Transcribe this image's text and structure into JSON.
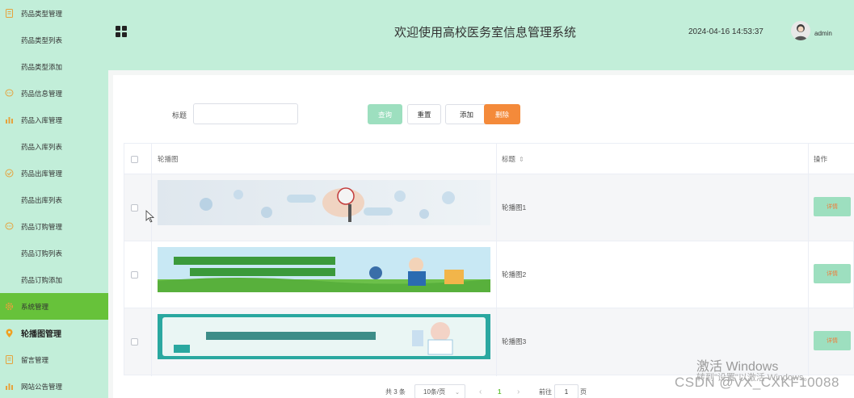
{
  "sidebar": {
    "items": [
      {
        "label": "药品类型管理",
        "type": "group",
        "icon": "document-icon"
      },
      {
        "label": "药品类型列表",
        "type": "sub"
      },
      {
        "label": "药品类型添加",
        "type": "sub"
      },
      {
        "label": "药品信息管理",
        "type": "group",
        "icon": "chat-icon"
      },
      {
        "label": "药品入库管理",
        "type": "group",
        "icon": "bar-chart-icon"
      },
      {
        "label": "药品入库列表",
        "type": "sub"
      },
      {
        "label": "药品出库管理",
        "type": "group",
        "icon": "check-circle-icon"
      },
      {
        "label": "药品出库列表",
        "type": "sub"
      },
      {
        "label": "药品订购管理",
        "type": "group",
        "icon": "chat-icon"
      },
      {
        "label": "药品订购列表",
        "type": "sub"
      },
      {
        "label": "药品订购添加",
        "type": "sub"
      },
      {
        "label": "系统管理",
        "type": "group",
        "icon": "gear-icon",
        "active": true
      },
      {
        "label": "轮播图管理",
        "type": "group",
        "icon": "location-pin-icon",
        "bold": true
      },
      {
        "label": "留言管理",
        "type": "group",
        "icon": "document-icon"
      },
      {
        "label": "网站公告管理",
        "type": "group",
        "icon": "bar-chart-icon"
      }
    ]
  },
  "header": {
    "title": "欢迎使用高校医务室信息管理系统",
    "datetime": "2024-04-16 14:53:37",
    "username": "admin"
  },
  "search": {
    "label": "标题",
    "value": "",
    "placeholder": ""
  },
  "buttons": {
    "query": "查询",
    "reset": "重置",
    "add": "添加",
    "delete": "删除"
  },
  "table": {
    "columns": {
      "image": "轮播图",
      "title": "标题",
      "sort_icon": "⇕",
      "action": "操作"
    },
    "rows": [
      {
        "title": "轮播图1",
        "action": "详情"
      },
      {
        "title": "轮播图2",
        "action": "详情"
      },
      {
        "title": "轮播图3",
        "action": "详情"
      }
    ]
  },
  "pagination": {
    "total": "共 3 条",
    "page_size": "10条/页",
    "prev": "‹",
    "current": "1",
    "next": "›",
    "goto_label": "前往",
    "goto_value": "1",
    "page_suffix": "页"
  },
  "watermark": {
    "line1": "激活 Windows",
    "line2": "转到\"设置\"以激活 Windows。",
    "csdn": "CSDN @VX_CXKF10088"
  },
  "colors": {
    "sidebar_bg": "#c2eed9",
    "active_bg": "#67c23a",
    "query_btn": "#9ddfbf",
    "delete_btn": "#f48a3a",
    "detail_text": "#f07c3a"
  }
}
